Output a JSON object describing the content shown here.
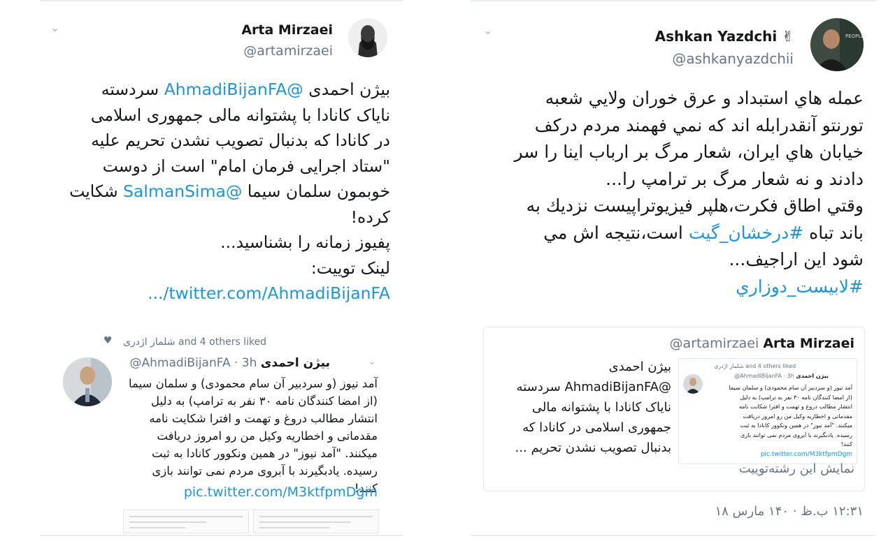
{
  "left_tweet": {
    "name": "Arta Mirzaei",
    "handle": "@artamirzaei",
    "lines": [
      {
        "pre": "بیژن احمدی ",
        "link": "@AhmadiBijanFA",
        "post": " سردسته"
      },
      {
        "pre": "نایاک کانادا با پشتوانه مالی جمهوری اسلامی",
        "link": "",
        "post": ""
      },
      {
        "pre": "در کانادا که بدنبال تصویب نشدن تحریم علیه",
        "link": "",
        "post": ""
      },
      {
        "pre": "\"ستاد اجرایی فرمان امام\" است از دوست",
        "link": "",
        "post": ""
      },
      {
        "pre": "خوبمون سلمان سیما ",
        "link": "@SalmanSima",
        "post": " شکایت"
      },
      {
        "pre": "کرده!",
        "link": "",
        "post": ""
      },
      {
        "pre": "پفیوز زمانه را بشناسید...",
        "link": "",
        "post": ""
      },
      {
        "pre": "لینک توییت:",
        "link": "",
        "post": ""
      },
      {
        "pre": "",
        "link": "twitter.com/AhmadiBijanFA/...",
        "post": ""
      }
    ],
    "liked_line": "شلماز اژدری and 4 others liked",
    "quoted": {
      "name": "بیژن احمدی",
      "handle": "@AhmadiBijanFA · 3h",
      "lines": [
        "آمد نیوز (و سردبیر آن سام محمودی) و سلمان سیما",
        "(از امضا کنندگان نامه ۳۰ نفر به ترامپ) به دلیل",
        "انتشار مطالب دروغ و تهمت و افترا شکایت نامه",
        "مقدماتی و اخطاریه وکیل من رو امروز دریافت",
        "میکنند. \"آمد نیوز\" در همین ونکوور کانادا به ثبت",
        "رسیده. یادبگیرند با آبروی مردم نمی توانند بازی",
        "کنند!"
      ],
      "pic_link": "pic.twitter.com/M3ktfpmDgm"
    }
  },
  "right_tweet": {
    "name": "Ashkan Yazdchi ✌",
    "handle": "@ashkanyazdchii",
    "lines": [
      {
        "pre": "عمله هاي استبداد و عرق خوران ولايي شعبه",
        "link": "",
        "post": ""
      },
      {
        "pre": "تورنتو آنقدرابله اند كه نمي فهمند مردم دركف",
        "link": "",
        "post": ""
      },
      {
        "pre": "خيابان هاي ايران، شعار مرگ بر ارباب اينا را سر",
        "link": "",
        "post": ""
      },
      {
        "pre": "دادند و نه شعار مرگ بر ترامپ را...",
        "link": "",
        "post": ""
      },
      {
        "pre": "وقتي اطاق فكرت،هلپر فيزيوتراپيست نزديك به",
        "link": "",
        "post": ""
      },
      {
        "pre": "باند تباه ",
        "link": "#درخشان_گيت",
        "post": " است،نتيجه اش مي"
      },
      {
        "pre": "شود اين اراجيف...",
        "link": "",
        "post": ""
      },
      {
        "pre": "",
        "link": "#لابيست_دوزاري",
        "post": ""
      }
    ],
    "quote": {
      "name": "Arta Mirzaei",
      "handle": "@artamirzaei",
      "lines": [
        "بیژن احمدی",
        "@AhmadiBijanFA سردسته",
        "نایاک کانادا با پشتوانه مالی",
        "جمهوری اسلامی در کانادا که",
        "بدنبال تصویب نشدن تحریم ..."
      ],
      "mini": {
        "liked": "شلماز اژدری and 4 others liked",
        "name": "بیژن احمدی",
        "handle": "@AhmadiBijanFA · 3h",
        "lines": [
          "آمد نیوز (و سردبیر آن سام محمودی) و سلمان سیما",
          "(از امضا کنندگان نامه ۳۰ نفر به ترامپ) به دلیل",
          "انتشار مطالب دروغ و تهمت و افترا شکایت نامه",
          "مقدماتی و اخطاریه وکیل من رو امروز دریافت",
          "میکنند. \"آمد نیوز\" در همین ونکوور کانادا به ثبت",
          "رسیده. یادبگیرند با آبروی مردم نمی توانند بازی",
          "کنند!"
        ],
        "pic_link": "pic.twitter.com/M3ktfpmDgm"
      },
      "show_thread": "نمایش این رشته‌توییت"
    },
    "timestamp": "۱۲:۳۱ ب.ظ · ۱۴۰ مارس ۱۸"
  },
  "colors": {
    "link": "#1b95e0",
    "muted": "#657786",
    "border": "#e1e8ed"
  },
  "icons": {
    "chevron": "chevron-down-icon",
    "heart": "heart-icon"
  }
}
